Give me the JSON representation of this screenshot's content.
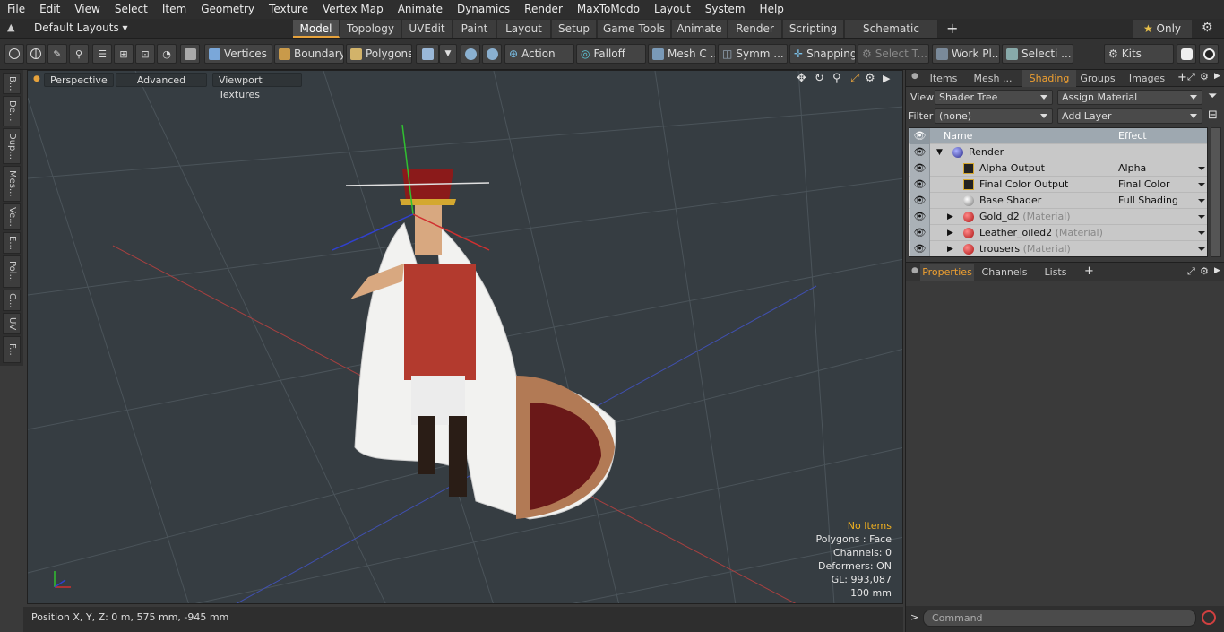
{
  "menu": [
    "File",
    "Edit",
    "View",
    "Select",
    "Item",
    "Geometry",
    "Texture",
    "Vertex Map",
    "Animate",
    "Dynamics",
    "Render",
    "MaxToModo",
    "Layout",
    "System",
    "Help"
  ],
  "layout_selector": "Default Layouts",
  "layout_tabs": [
    "Model",
    "Topology",
    "UVEdit",
    "Paint",
    "Layout",
    "Setup",
    "Game Tools",
    "Animate",
    "Render",
    "Scripting",
    "Schematic Fusion"
  ],
  "only_label": "Only",
  "toolbar": {
    "vertices": "Vertices",
    "boundary": "Boundary",
    "polygons": "Polygons",
    "action": "Action",
    "falloff": "Falloff",
    "mesh_c": "Mesh C ...",
    "symm": "Symm ...",
    "snapping": "Snapping",
    "select_t": "Select T...",
    "work_pl": "Work Pl...",
    "selecti": "Selecti ...",
    "kits": "Kits"
  },
  "left_strip": [
    "B...",
    "De...",
    "Dup...",
    "Mes...",
    "Ve...",
    "E...",
    "Pol...",
    "C...",
    "UV",
    "F..."
  ],
  "viewport": {
    "perspective": "Perspective",
    "advanced": "Advanced",
    "textures": "Viewport Textures",
    "stats_title": "No Items",
    "stats": [
      "Polygons : Face",
      "Channels: 0",
      "Deformers: ON",
      "GL: 993,087",
      "100 mm"
    ]
  },
  "status": "Position X, Y, Z:   0 m, 575 mm, -945 mm",
  "panel": {
    "tabs": [
      "Items",
      "Mesh ...",
      "Shading",
      "Groups",
      "Images"
    ],
    "view_label": "View",
    "view_value": "Shader Tree",
    "assign": "Assign Material",
    "filter_label": "Filter",
    "filter_value": "(none)",
    "add_layer": "Add Layer",
    "col_name": "Name",
    "col_effect": "Effect",
    "rows": [
      {
        "name": "Render",
        "tag": "",
        "effect": ""
      },
      {
        "name": "Alpha Output",
        "tag": "",
        "effect": "Alpha"
      },
      {
        "name": "Final Color Output",
        "tag": "",
        "effect": "Final Color"
      },
      {
        "name": "Base Shader",
        "tag": "",
        "effect": "Full Shading"
      },
      {
        "name": "Gold_d2",
        "tag": "(Material)",
        "effect": ""
      },
      {
        "name": "Leather_oiled2",
        "tag": "(Material)",
        "effect": ""
      },
      {
        "name": "trousers",
        "tag": "(Material)",
        "effect": ""
      }
    ],
    "sub_tabs": [
      "Properties",
      "Channels",
      "Lists"
    ],
    "command_placeholder": "Command"
  },
  "colors": {
    "accent": "#e6a23c",
    "viewport_bg": "#363d42",
    "tree_bg": "#c8c8c8"
  }
}
